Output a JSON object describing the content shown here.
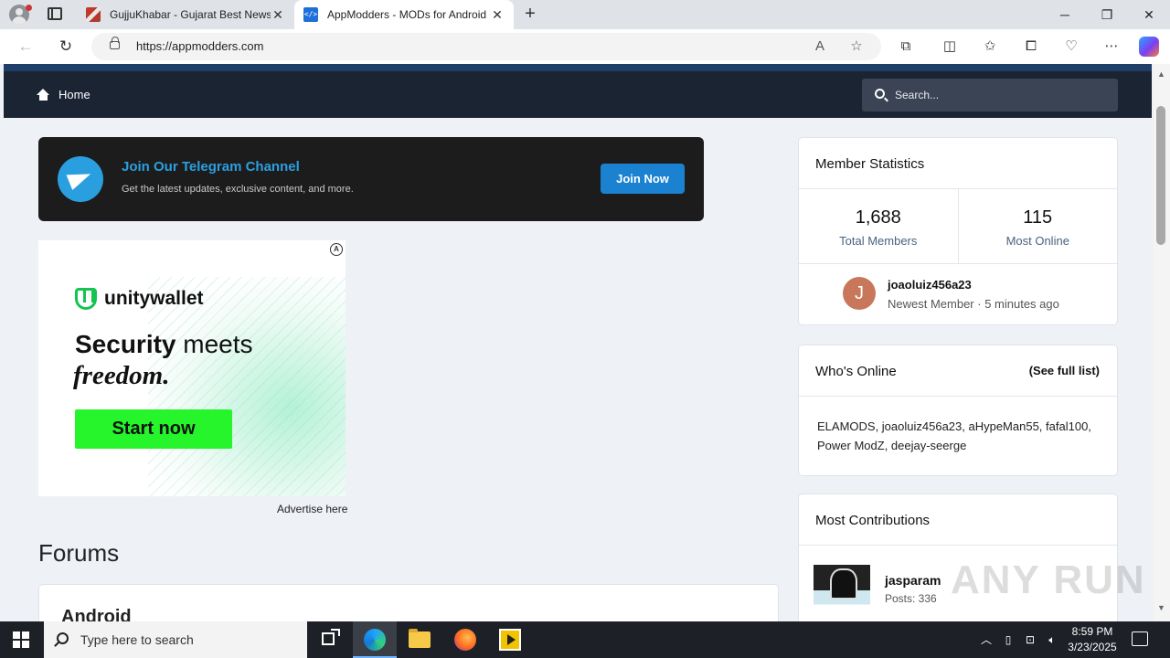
{
  "browser": {
    "tabs": [
      {
        "title": "GujjuKhabar - Gujarat Best News",
        "active": false
      },
      {
        "title": "AppModders - MODs for Android",
        "active": true
      }
    ],
    "active_favicon_glyph": "</>",
    "url": "https://appmodders.com",
    "new_tab_glyph": "+",
    "window_controls": {
      "minimize": "─",
      "restore": "❐",
      "close": "✕"
    },
    "toolbar_icons": [
      "back-icon",
      "refresh-icon",
      "lock-icon",
      "read-aloud-icon",
      "favorite-star-icon",
      "extensions-icon",
      "split-screen-icon",
      "favorites-icon",
      "collections-icon",
      "performance-icon",
      "more-menu-icon",
      "copilot-icon"
    ]
  },
  "site": {
    "nav": {
      "home_label": "Home",
      "search_placeholder": "Search..."
    },
    "telegram": {
      "title": "Join Our Telegram Channel",
      "subtitle": "Get the latest updates, exclusive content, and more.",
      "button": "Join Now"
    },
    "ad": {
      "brand": "unitywallet",
      "headline_bold": "Security",
      "headline_rest": " meets",
      "headline_line2": "freedom.",
      "cta": "Start now",
      "adchoices_glyph": "A",
      "advertise_link": "Advertise here"
    },
    "forums": {
      "heading": "Forums",
      "first_forum": "Android"
    },
    "member_stats": {
      "title": "Member Statistics",
      "total_members": "1,688",
      "total_members_label": "Total Members",
      "most_online": "115",
      "most_online_label": "Most Online",
      "newest_initial": "J",
      "newest_name": "joaoluiz456a23",
      "newest_meta": "Newest Member · 5 minutes ago"
    },
    "whos_online": {
      "title": "Who's Online",
      "link": "(See full list)",
      "list": "ELAMODS, joaoluiz456a23, aHypeMan55, fafal100, Power ModZ, deejay-seerge"
    },
    "most_contributions": {
      "title": "Most Contributions",
      "top_user": "jasparam",
      "top_posts": "Posts: 336"
    },
    "watermark": "ANY RUN"
  },
  "taskbar": {
    "search_placeholder": "Type here to search",
    "time": "8:59 PM",
    "date": "3/23/2025",
    "apps": [
      "task-view-icon",
      "edge-icon",
      "file-explorer-icon",
      "firefox-icon",
      "media-player-icon"
    ]
  }
}
